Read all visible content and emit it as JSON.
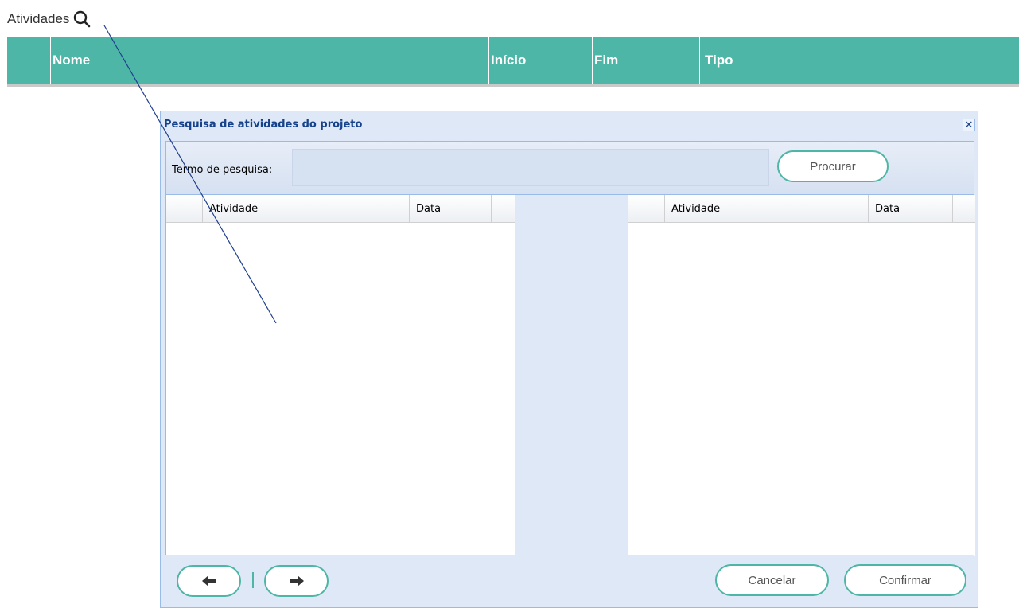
{
  "header": {
    "title": "Atividades",
    "search_icon": "search-icon"
  },
  "main_table": {
    "columns": [
      "Nome",
      "Início",
      "Fim",
      "Tipo"
    ]
  },
  "dialog": {
    "title": "Pesquisa de atividades do projeto",
    "close_icon": "close-icon",
    "search": {
      "label": "Termo de pesquisa:",
      "value": "",
      "button": "Procurar"
    },
    "left_grid": {
      "columns": [
        "Atividade",
        "Data"
      ],
      "rows": []
    },
    "right_grid": {
      "columns": [
        "Atividade",
        "Data"
      ],
      "rows": []
    },
    "footer": {
      "prev_icon": "arrow-left-icon",
      "next_icon": "arrow-right-icon",
      "cancel": "Cancelar",
      "confirm": "Confirmar"
    }
  },
  "colors": {
    "accent": "#4db6a6",
    "dialog_bg": "#dfe8f6",
    "dialog_title": "#15428b"
  }
}
